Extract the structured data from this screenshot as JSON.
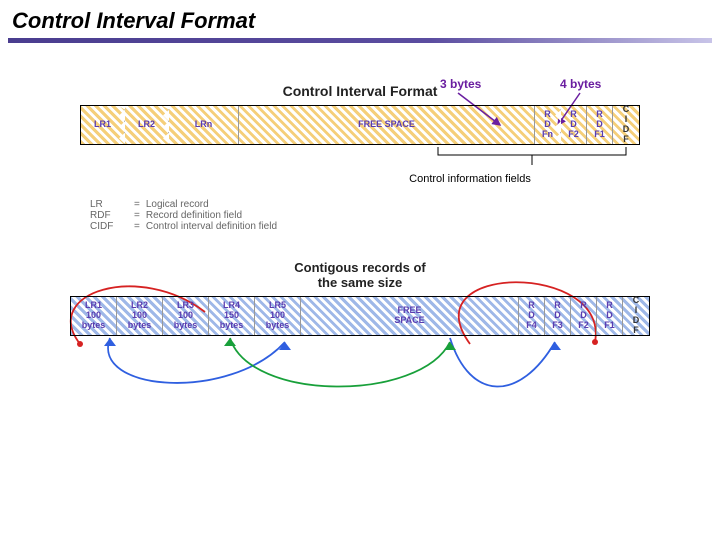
{
  "title": "Control Interval Format",
  "diagram1": {
    "heading": "Control Interval Format",
    "annot3": "3 bytes",
    "annot4": "4 bytes",
    "cells": [
      "LR1",
      "LR2",
      "LRn",
      "FREE SPACE",
      "R\nD\nFn",
      "R\nD\nF2",
      "R\nD\nF1",
      "C\nI\nD\nF"
    ],
    "bracket_label": "Control information fields"
  },
  "legend": {
    "rows": [
      {
        "k": "LR",
        "eq": "=",
        "v": "Logical record"
      },
      {
        "k": "RDF",
        "eq": "=",
        "v": "Record definition field"
      },
      {
        "k": "CIDF",
        "eq": "=",
        "v": "Control interval definition field"
      }
    ]
  },
  "diagram2": {
    "heading": "Contigous records of\nthe same size",
    "cells": [
      "LR1\n100\nbytes",
      "LR2\n100\nbytes",
      "LR3\n100\nbytes",
      "LR4\n150\nbytes",
      "LR5\n100\nbytes",
      "FREE\nSPACE",
      "R\nD\nF4",
      "R\nD\nF3",
      "R\nD\nF2",
      "R\nD\nF1",
      "C\nI\nD\nF"
    ]
  }
}
